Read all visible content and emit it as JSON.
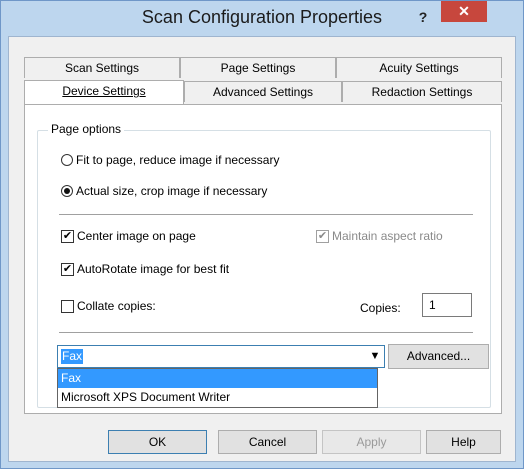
{
  "window": {
    "title": "Scan Configuration Properties",
    "help_label": "?",
    "close_label": "✕"
  },
  "tabs": {
    "row1": [
      "Scan Settings",
      "Page Settings",
      "Acuity Settings"
    ],
    "row2": [
      "Device Settings",
      "Advanced Settings",
      "Redaction Settings"
    ],
    "active": "Device Settings"
  },
  "page_options": {
    "legend": "Page options",
    "fit_label": "Fit to page, reduce image if necessary",
    "fit_selected": false,
    "actual_label": "Actual size, crop image if necessary",
    "actual_selected": true,
    "center_label": "Center image on page",
    "center_checked": true,
    "aspect_label": "Maintain aspect ratio",
    "aspect_checked": true,
    "aspect_enabled": false,
    "autorotate_label": "AutoRotate image for best fit",
    "autorotate_checked": true,
    "collate_label": "Collate copies:",
    "collate_checked": false,
    "copies_label": "Copies:",
    "copies_value": "1"
  },
  "printer": {
    "selected": "Fax",
    "options": [
      "Fax",
      "Microsoft XPS Document Writer"
    ],
    "advanced_label": "Advanced..."
  },
  "footer": {
    "ok_label": "OK",
    "cancel_label": "Cancel",
    "apply_label": "Apply",
    "help_label": "Help"
  }
}
